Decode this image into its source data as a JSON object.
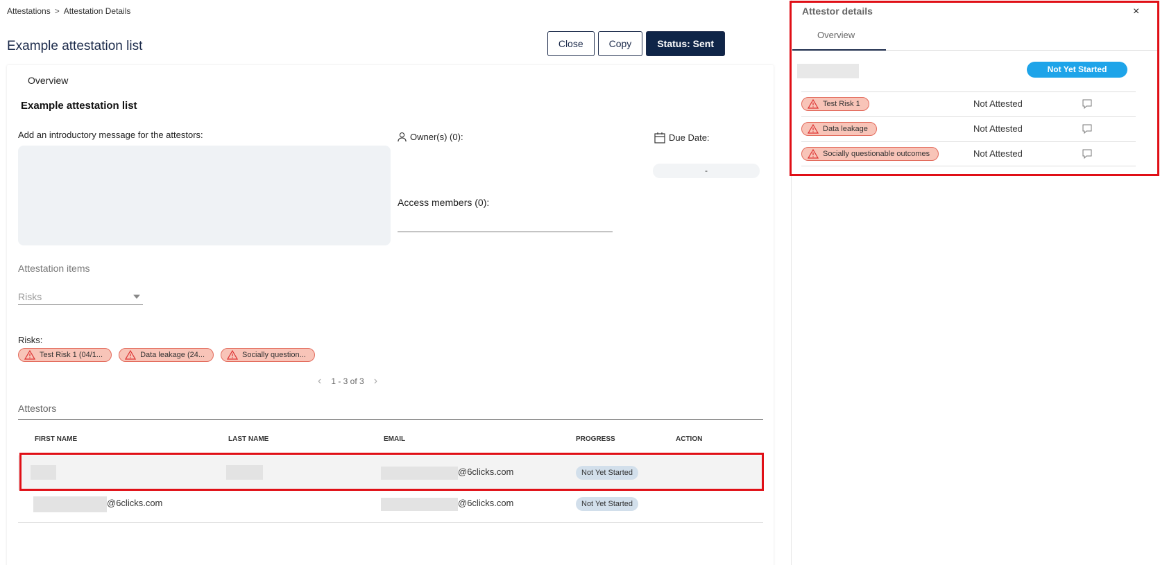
{
  "breadcrumb": {
    "root": "Attestations",
    "separator": ">",
    "current": "Attestation Details"
  },
  "page": {
    "title": "Example attestation list"
  },
  "actions": {
    "close": "Close",
    "copy": "Copy",
    "status": "Status: Sent"
  },
  "card": {
    "tab": "Overview",
    "list_title": "Example attestation list",
    "intro_label": "Add an introductory message for the attestors:",
    "owners_label": "Owner(s) (0):",
    "access_label": "Access members (0):",
    "due_label": "Due Date:",
    "due_value": "-",
    "items_label": "Attestation items",
    "items_select": "Risks",
    "risks_label": "Risks:",
    "risk_chips": [
      "Test Risk 1 (04/1...",
      "Data leakage (24...",
      "Socially question..."
    ],
    "pager": "1 - 3 of 3",
    "attestors_label": "Attestors",
    "columns": [
      "FIRST NAME",
      "LAST NAME",
      "EMAIL",
      "PROGRESS",
      "ACTION"
    ],
    "rows": [
      {
        "first": "",
        "last": "",
        "email_suffix": "@6clicks.com",
        "progress": "Not Yet Started"
      },
      {
        "first_suffix": "@6clicks.com",
        "email_suffix": "@6clicks.com",
        "progress": "Not Yet Started"
      }
    ]
  },
  "panel": {
    "title": "Attestor details",
    "close": "×",
    "tab": "Overview",
    "status": "Not Yet Started",
    "items": [
      {
        "risk": "Test Risk 1",
        "status": "Not Attested"
      },
      {
        "risk": "Data leakage",
        "status": "Not Attested"
      },
      {
        "risk": "Socially questionable outcomes",
        "status": "Not Attested"
      }
    ]
  },
  "colors": {
    "navy": "#0f2548",
    "risk_chip_bg": "#f8c4b8",
    "risk_chip_border": "#e36b5c",
    "status_blue": "#1ea4e9",
    "highlight_red": "#e00f16"
  }
}
